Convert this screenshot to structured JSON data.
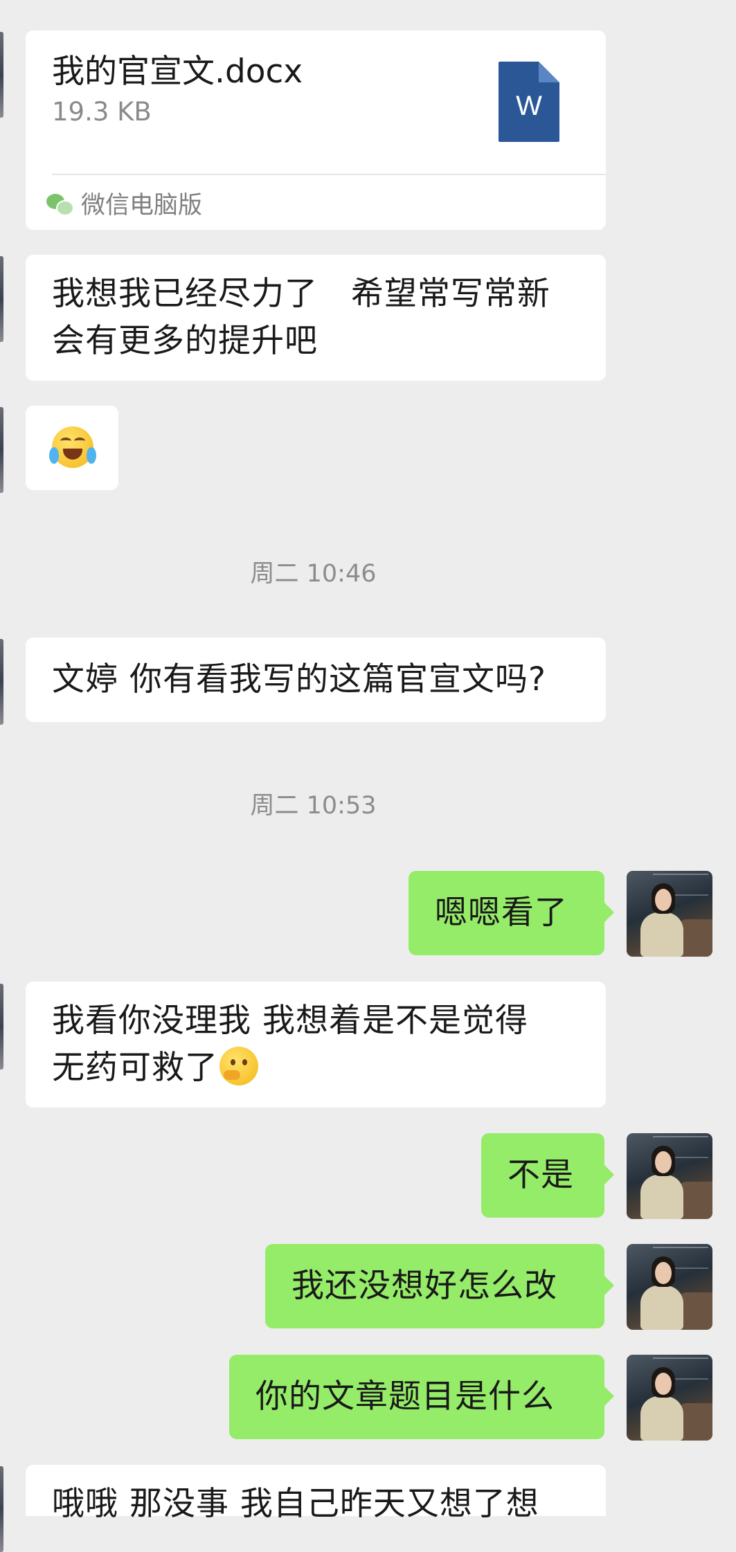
{
  "file_message": {
    "file_name": "我的官宣文.docx",
    "file_size": "19.3 KB",
    "file_icon": "word-doc-icon",
    "file_icon_letter": "W",
    "source_icon": "wechat-icon",
    "source_label": "微信电脑版"
  },
  "messages": [
    {
      "id": "m1",
      "side": "left",
      "lines": [
        "我想我已经尽力了   希望常写常新",
        "会有更多的提升吧"
      ]
    },
    {
      "id": "m2",
      "side": "left",
      "emoji": "rolling-on-floor-laughing-icon"
    },
    {
      "id": "m3",
      "side": "left",
      "text": "文婷 你有看我写的这篇官宣文吗?"
    },
    {
      "id": "m4",
      "side": "right",
      "text": "嗯嗯看了"
    },
    {
      "id": "m5",
      "side": "left",
      "lines": [
        "我看你没理我 我想着是不是觉得",
        "无药可救了"
      ],
      "trailing_emoji": "thinking-face-icon"
    },
    {
      "id": "m6",
      "side": "right",
      "text": "不是"
    },
    {
      "id": "m7",
      "side": "right",
      "text": "我还没想好怎么改"
    },
    {
      "id": "m8",
      "side": "right",
      "text": "你的文章题目是什么"
    },
    {
      "id": "m9",
      "side": "left",
      "text": "哦哦 那没事 我自己昨天又想了想"
    }
  ],
  "timestamps": [
    "周二 10:46",
    "周二 10:53"
  ],
  "colors": {
    "background": "#ededed",
    "incoming_bubble": "#ffffff",
    "outgoing_bubble": "#95ec69",
    "word_icon": "#2b5797",
    "timestamp_text": "#8c8c8c"
  }
}
